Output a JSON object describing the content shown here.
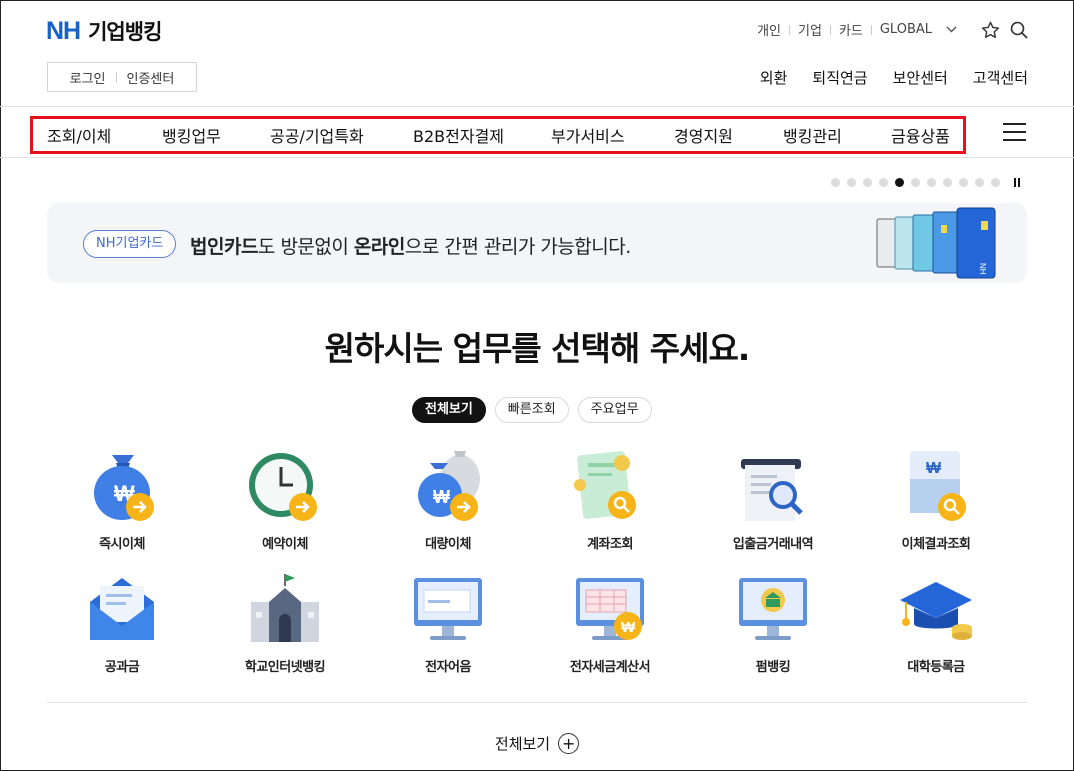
{
  "brand": {
    "logo_mark": "NH",
    "logo_text": "기업뱅킹",
    "accent": "#1762c6"
  },
  "util": {
    "login": "로그인",
    "cert_center": "인증센터"
  },
  "top_nav": {
    "items": [
      "개인",
      "기업",
      "카드",
      "GLOBAL"
    ],
    "icons": [
      "chevron-down-icon",
      "star-icon",
      "search-icon"
    ]
  },
  "sub_nav": [
    "외환",
    "퇴직연금",
    "보안센터",
    "고객센터"
  ],
  "gnb": {
    "items": [
      "조회/이체",
      "뱅킹업무",
      "공공/기업특화",
      "B2B전자결제",
      "부가서비스",
      "경영지원",
      "뱅킹관리",
      "금융상품"
    ],
    "highlight_color": "#e8101c"
  },
  "carousel": {
    "total": 11,
    "current": 4
  },
  "banner": {
    "badge": "NH기업카드",
    "bold1": "법인카드",
    "text1": "도 방문없이 ",
    "bold2": "온라인",
    "text2": "으로 간편 관리가 가능합니다."
  },
  "main_title": "원하시는 업무를 선택해 주세요.",
  "tabs": [
    "전체보기",
    "빠른조회",
    "주요업무"
  ],
  "services": [
    {
      "label": "즉시이체",
      "icon": "money-bag-arrow-icon"
    },
    {
      "label": "예약이체",
      "icon": "clock-arrow-icon"
    },
    {
      "label": "대량이체",
      "icon": "money-bags-arrow-icon"
    },
    {
      "label": "계좌조회",
      "icon": "account-search-icon"
    },
    {
      "label": "입출금거래내역",
      "icon": "statement-search-icon"
    },
    {
      "label": "이체결과조회",
      "icon": "transfer-result-icon"
    },
    {
      "label": "공과금",
      "icon": "envelope-icon"
    },
    {
      "label": "학교인터넷뱅킹",
      "icon": "school-icon"
    },
    {
      "label": "전자어음",
      "icon": "monitor-bill-icon"
    },
    {
      "label": "전자세금계산서",
      "icon": "monitor-tax-invoice-icon"
    },
    {
      "label": "펌뱅킹",
      "icon": "monitor-bank-icon"
    },
    {
      "label": "대학등록금",
      "icon": "graduation-cap-icon"
    }
  ],
  "view_all": "전체보기"
}
